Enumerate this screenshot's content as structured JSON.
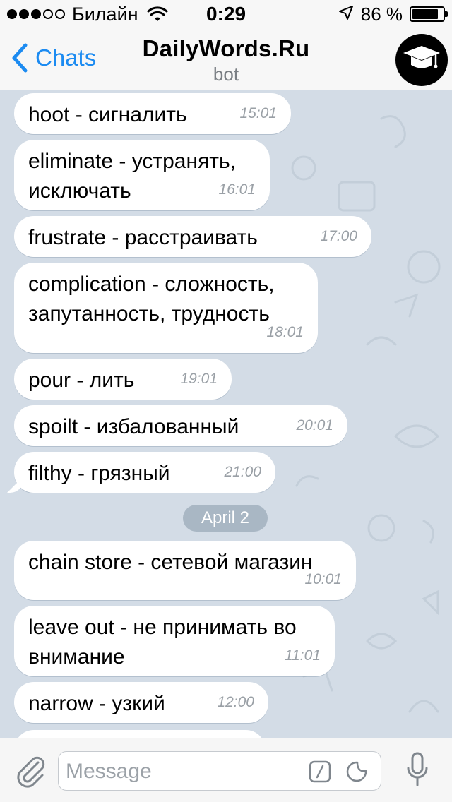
{
  "status_bar": {
    "carrier": "Билайн",
    "time": "0:29",
    "battery_percent": "86 %",
    "battery_level": 0.86,
    "signal_bars_filled": 3,
    "signal_bars_total": 5,
    "icons": [
      "wifi-icon",
      "location-arrow-icon",
      "battery-icon"
    ]
  },
  "nav": {
    "back_label": "Chats",
    "title": "DailyWords.Ru",
    "subtitle": "bot",
    "avatar_icon": "graduation-cap-icon"
  },
  "messages": [
    {
      "word": "hoot",
      "translation": " - сигналить",
      "time": "15:01"
    },
    {
      "word": "eliminate",
      "translation": " - устранять, исключать",
      "time": "16:01"
    },
    {
      "word": "frustrate",
      "translation": " - расстраивать",
      "time": "17:00"
    },
    {
      "word": "complication",
      "translation": " - сложность, запутанность, трудность",
      "time": "18:01"
    },
    {
      "word": "pour",
      "translation": " - лить",
      "time": "19:01"
    },
    {
      "word": "spoilt",
      "translation": " - избалованный",
      "time": "20:01"
    },
    {
      "word": "filthy",
      "translation": " - грязный",
      "time": "21:00"
    },
    {
      "word": "chain store",
      "translation": " - сетевой магазин",
      "time": "10:01"
    },
    {
      "word": "leave out",
      "translation": " - не принимать во внимание",
      "time": "11:01"
    },
    {
      "word": "narrow",
      "translation": " - узкий",
      "time": "12:00"
    }
  ],
  "date_separator": "April 2",
  "input": {
    "placeholder": "Message",
    "value": "",
    "icons": [
      "paperclip-icon",
      "bot-command-icon",
      "sticker-icon",
      "microphone-icon"
    ]
  },
  "colors": {
    "accent": "#1c8bf1",
    "chat_background": "#d3dce6",
    "bubble": "#ffffff",
    "time_text": "#9aa0a6",
    "date_pill": "#a9b7c4"
  }
}
